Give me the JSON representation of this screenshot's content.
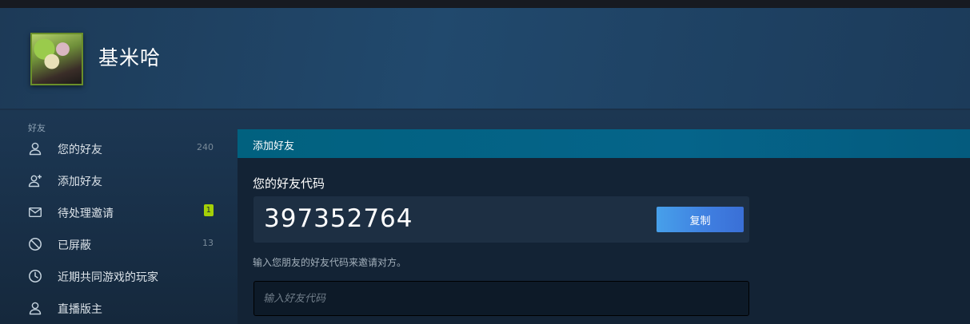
{
  "profile": {
    "name": "基米哈"
  },
  "sidebar": {
    "section_title": "好友",
    "items": [
      {
        "label": "您的好友",
        "icon": "person-icon",
        "count": "240"
      },
      {
        "label": "添加好友",
        "icon": "add-person-icon"
      },
      {
        "label": "待处理邀请",
        "icon": "envelope-icon",
        "badge": "1"
      },
      {
        "label": "已屏蔽",
        "icon": "block-icon",
        "count": "13"
      },
      {
        "label": "近期共同游戏的玩家",
        "icon": "clock-icon"
      },
      {
        "label": "直播版主",
        "icon": "person-icon"
      }
    ]
  },
  "content": {
    "header": "添加好友",
    "code_title": "您的好友代码",
    "friend_code": "397352764",
    "copy_label": "复制",
    "hint": "输入您朋友的好友代码来邀请对方。",
    "input_placeholder": "输入好友代码",
    "input_value": ""
  },
  "colors": {
    "accent_header": "#05648a",
    "copy_button": "#3f7ee0",
    "badge": "#a4d007"
  }
}
